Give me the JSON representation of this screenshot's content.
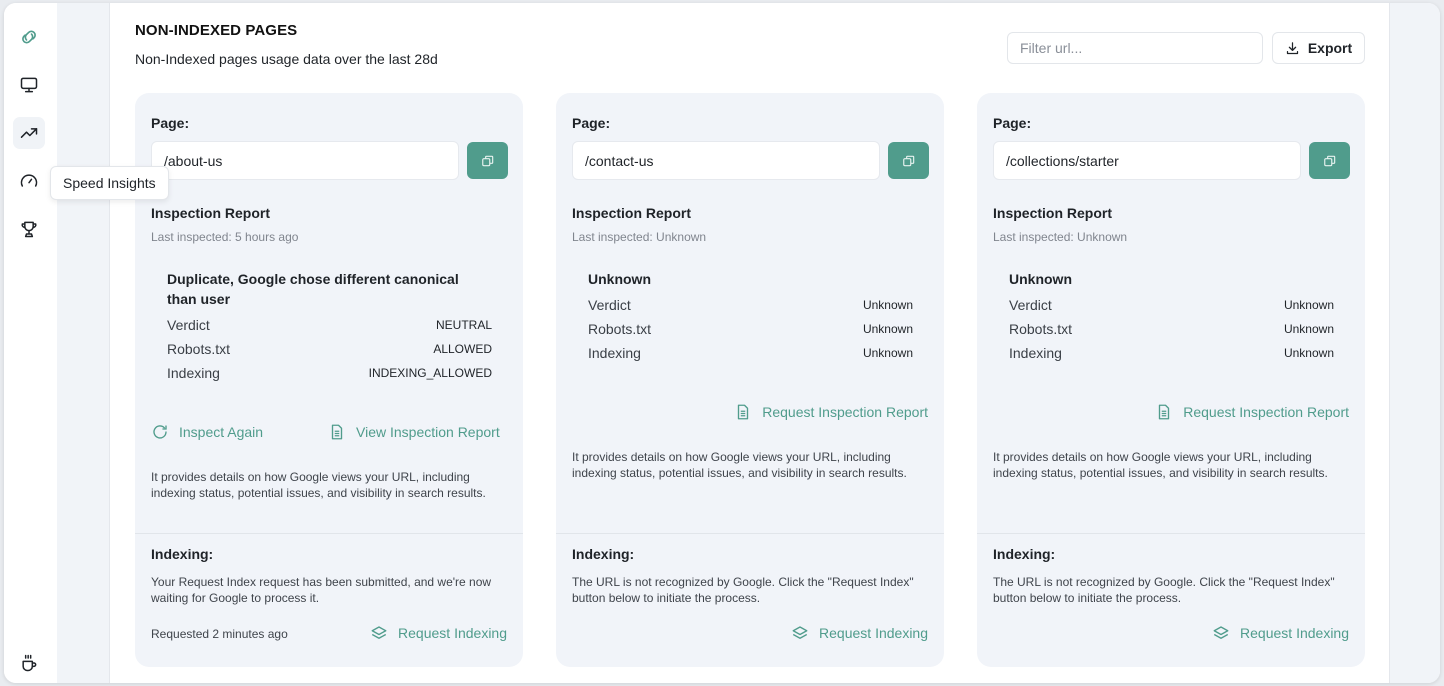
{
  "sidebar": {
    "items": [
      {
        "icon": "link-icon",
        "label": "Links"
      },
      {
        "icon": "monitor-icon",
        "label": "Pages"
      },
      {
        "icon": "trending-up-icon",
        "label": "Analytics",
        "active": true
      },
      {
        "icon": "gauge-icon",
        "label": "Speed Insights"
      },
      {
        "icon": "trophy-icon",
        "label": "Achievements"
      },
      {
        "icon": "coffee-icon",
        "label": "Support"
      }
    ],
    "tooltip": "Speed Insights"
  },
  "header": {
    "title": "NON-INDEXED PAGES",
    "subtitle": "Non-Indexed pages usage data over the last 28d",
    "filter_placeholder": "Filter url...",
    "filter_value": "",
    "export_label": "Export"
  },
  "colors": {
    "accent": "#509c8c",
    "card_bg": "#f1f4f9"
  },
  "cards": [
    {
      "page_label": "Page:",
      "url": "/about-us",
      "report_title": "Inspection Report",
      "last_inspected": "Last inspected: 5 hours ago",
      "status": "Duplicate, Google chose different canonical than user",
      "rows": [
        {
          "key": "Verdict",
          "value": "NEUTRAL"
        },
        {
          "key": "Robots.txt",
          "value": "ALLOWED"
        },
        {
          "key": "Indexing",
          "value": "INDEXING_ALLOWED"
        }
      ],
      "actions": [
        "Inspect Again",
        "View Inspection Report"
      ],
      "description": "It provides details on how Google views your URL, including indexing status, potential issues, and visibility in search results.",
      "indexing_label": "Indexing:",
      "indexing_description": "Your Request Index request has been submitted, and we're now waiting for Google to process it.",
      "requested": "Requested 2 minutes ago",
      "request_indexing_label": "Request Indexing"
    },
    {
      "page_label": "Page:",
      "url": "/contact-us",
      "report_title": "Inspection Report",
      "last_inspected": "Last inspected: Unknown",
      "status": "Unknown",
      "rows": [
        {
          "key": "Verdict",
          "value": "Unknown"
        },
        {
          "key": "Robots.txt",
          "value": "Unknown"
        },
        {
          "key": "Indexing",
          "value": "Unknown"
        }
      ],
      "actions": [
        "Request Inspection Report"
      ],
      "description": "It provides details on how Google views your URL, including indexing status, potential issues, and visibility in search results.",
      "indexing_label": "Indexing:",
      "indexing_description": "The URL is not recognized by Google. Click the \"Request Index\" button below to initiate the process.",
      "request_indexing_label": "Request Indexing"
    },
    {
      "page_label": "Page:",
      "url": "/collections/starter",
      "report_title": "Inspection Report",
      "last_inspected": "Last inspected: Unknown",
      "status": "Unknown",
      "rows": [
        {
          "key": "Verdict",
          "value": "Unknown"
        },
        {
          "key": "Robots.txt",
          "value": "Unknown"
        },
        {
          "key": "Indexing",
          "value": "Unknown"
        }
      ],
      "actions": [
        "Request Inspection Report"
      ],
      "description": "It provides details on how Google views your URL, including indexing status, potential issues, and visibility in search results.",
      "indexing_label": "Indexing:",
      "indexing_description": "The URL is not recognized by Google. Click the \"Request Index\" button below to initiate the process.",
      "request_indexing_label": "Request Indexing"
    }
  ]
}
